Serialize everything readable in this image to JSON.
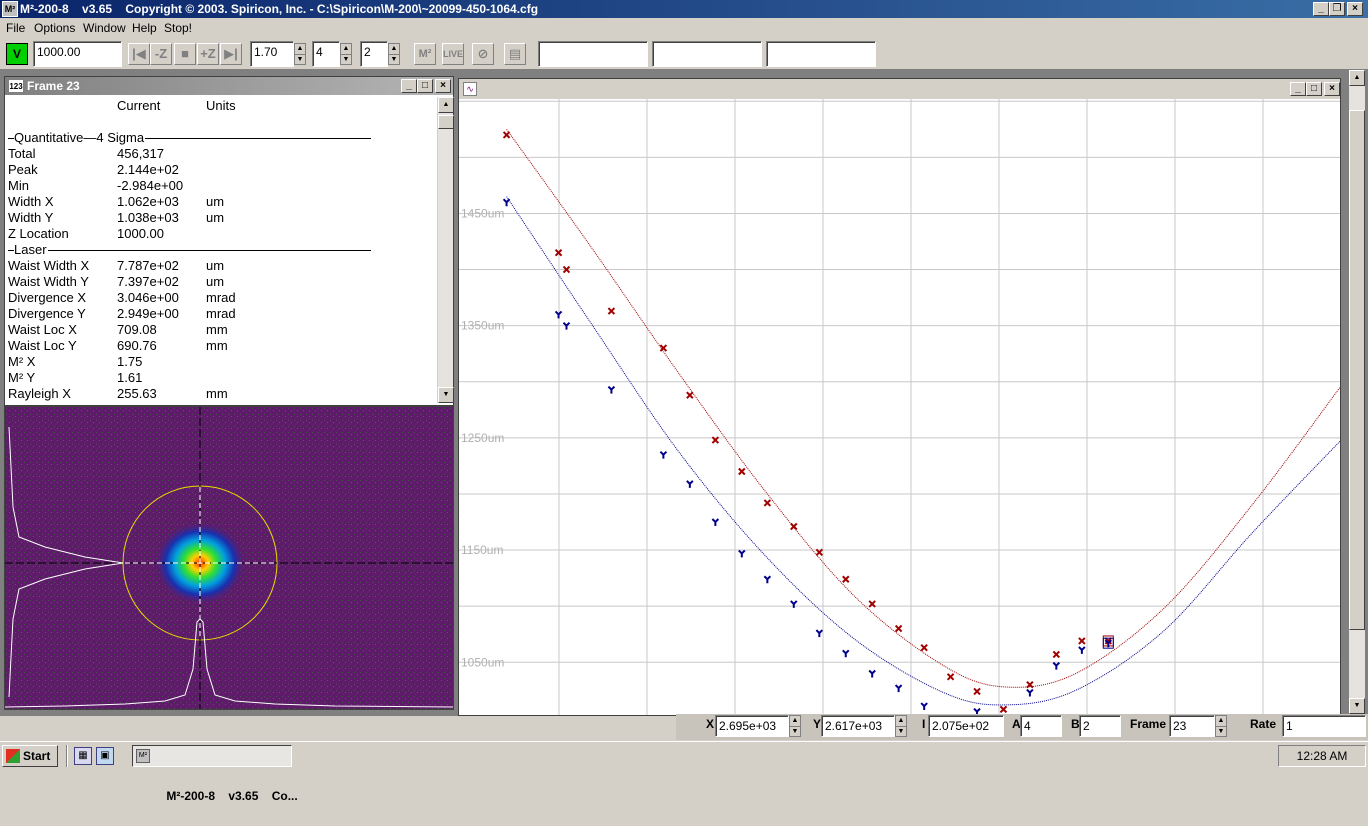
{
  "window": {
    "title": "M²-200-8    v3.65    Copyright © 2003. Spiricon, Inc. - C:\\Spiricon\\M-200\\~20099-450-1064.cfg"
  },
  "menu": [
    "File",
    "Options",
    "Window",
    "Help",
    "Stop!"
  ],
  "toolbar": {
    "v_label": "V",
    "position_value": "1000.00",
    "minus_z": "-Z",
    "plus_z": "+Z",
    "m2_spin_value": "1.70",
    "spin2_value": "4",
    "spin3_value": "2",
    "m2_button": "M²",
    "live_button": "LIVE"
  },
  "frame_panel": {
    "title": "Frame 23",
    "icon_text": "123",
    "headers": {
      "current": "Current",
      "units": "Units"
    },
    "rows": [
      {
        "type": "section",
        "label": "Quantitative—4 Sigma"
      },
      {
        "type": "value",
        "label": "Total",
        "current": "456,317",
        "units": ""
      },
      {
        "type": "value",
        "label": "Peak",
        "current": "2.144e+02",
        "units": ""
      },
      {
        "type": "value",
        "label": "Min",
        "current": "-2.984e+00",
        "units": ""
      },
      {
        "type": "value",
        "label": "Width X",
        "current": "1.062e+03",
        "units": "um"
      },
      {
        "type": "value",
        "label": "Width Y",
        "current": "1.038e+03",
        "units": "um"
      },
      {
        "type": "value",
        "label": "Z Location",
        "current": "1000.00",
        "units": ""
      },
      {
        "type": "section",
        "label": "Laser"
      },
      {
        "type": "value",
        "label": "Waist Width X",
        "current": "7.787e+02",
        "units": "um"
      },
      {
        "type": "value",
        "label": "Waist Width Y",
        "current": "7.397e+02",
        "units": "um"
      },
      {
        "type": "value",
        "label": "Divergence X",
        "current": "3.046e+00",
        "units": "mrad"
      },
      {
        "type": "value",
        "label": "Divergence Y",
        "current": "2.949e+00",
        "units": "mrad"
      },
      {
        "type": "value",
        "label": "Waist Loc X",
        "current": "709.08",
        "units": "mm"
      },
      {
        "type": "value",
        "label": "Waist Loc Y",
        "current": "690.76",
        "units": "mm"
      },
      {
        "type": "value",
        "label": "M² X",
        "current": "1.75",
        "units": ""
      },
      {
        "type": "value",
        "label": "M² Y",
        "current": "1.61",
        "units": ""
      },
      {
        "type": "value",
        "label": "Rayleigh X",
        "current": "255.63",
        "units": "mm"
      }
    ]
  },
  "colors": {
    "beam_background": "#5e1b6a",
    "series_x": "#a00000",
    "series_y": "#00008c",
    "title_active": "#0a246a",
    "title_inactive": "#808080",
    "v_button": "#00d000"
  },
  "chart_data": {
    "type": "scatter",
    "y_tick_labels": [
      "1450um",
      "1350um",
      "1250um",
      "1150um",
      "1050um"
    ],
    "y_ticks": [
      1450,
      1350,
      1250,
      1150,
      1050
    ],
    "ylim": [
      1003,
      1552
    ],
    "xlim": [
      0,
      100
    ],
    "grid": true,
    "series": [
      {
        "marker": "x",
        "color": "#a00000",
        "points": [
          [
            5.4,
            1520
          ],
          [
            11.3,
            1415
          ],
          [
            12.2,
            1400
          ],
          [
            17.3,
            1363
          ],
          [
            23.2,
            1330
          ],
          [
            26.2,
            1288
          ],
          [
            29.1,
            1248
          ],
          [
            32.1,
            1220
          ],
          [
            35.0,
            1192
          ],
          [
            38.0,
            1171
          ],
          [
            40.9,
            1148
          ],
          [
            43.9,
            1124
          ],
          [
            46.9,
            1102
          ],
          [
            49.9,
            1080
          ],
          [
            52.8,
            1063
          ],
          [
            55.8,
            1037
          ],
          [
            58.8,
            1024
          ],
          [
            61.8,
            1008
          ],
          [
            64.8,
            1030
          ],
          [
            67.8,
            1057
          ],
          [
            70.7,
            1069
          ],
          [
            73.7,
            1069
          ]
        ],
        "fit": [
          [
            5.4,
            1525
          ],
          [
            15,
            1420
          ],
          [
            25,
            1307
          ],
          [
            35,
            1200
          ],
          [
            45,
            1108
          ],
          [
            55,
            1047
          ],
          [
            62,
            1028
          ],
          [
            70,
            1040
          ],
          [
            80,
            1098
          ],
          [
            90,
            1190
          ],
          [
            100,
            1295
          ]
        ]
      },
      {
        "marker": "y",
        "color": "#00008c",
        "points": [
          [
            5.4,
            1460
          ],
          [
            11.3,
            1360
          ],
          [
            12.2,
            1350
          ],
          [
            17.3,
            1293
          ],
          [
            23.2,
            1235
          ],
          [
            26.2,
            1209
          ],
          [
            29.1,
            1175
          ],
          [
            32.1,
            1147
          ],
          [
            35.0,
            1124
          ],
          [
            38.0,
            1102
          ],
          [
            40.9,
            1076
          ],
          [
            43.9,
            1058
          ],
          [
            46.9,
            1040
          ],
          [
            49.9,
            1027
          ],
          [
            52.8,
            1011
          ],
          [
            58.8,
            1006
          ],
          [
            64.8,
            1023
          ],
          [
            67.8,
            1047
          ],
          [
            70.7,
            1061
          ],
          [
            73.7,
            1067
          ]
        ],
        "fit": [
          [
            5.4,
            1465
          ],
          [
            15,
            1352
          ],
          [
            25,
            1237
          ],
          [
            35,
            1143
          ],
          [
            45,
            1070
          ],
          [
            55,
            1023
          ],
          [
            62,
            1012
          ],
          [
            70,
            1025
          ],
          [
            80,
            1078
          ],
          [
            90,
            1165
          ],
          [
            100,
            1247
          ]
        ]
      }
    ]
  },
  "status": {
    "x_label": "X",
    "x_value": "2.695e+03",
    "y_label": "Y",
    "y_value": "2.617e+03",
    "i_label": "I",
    "i_value": "2.075e+02",
    "a_label": "A",
    "a_value": "4",
    "b_label": "B",
    "b_value": "2",
    "frame_label": "Frame",
    "frame_value": "23",
    "rate_label": "Rate",
    "rate_value": "1"
  },
  "taskbar": {
    "start": "Start",
    "task_title": "M²-200-8    v3.65    Co...",
    "clock": "12:28 AM"
  }
}
